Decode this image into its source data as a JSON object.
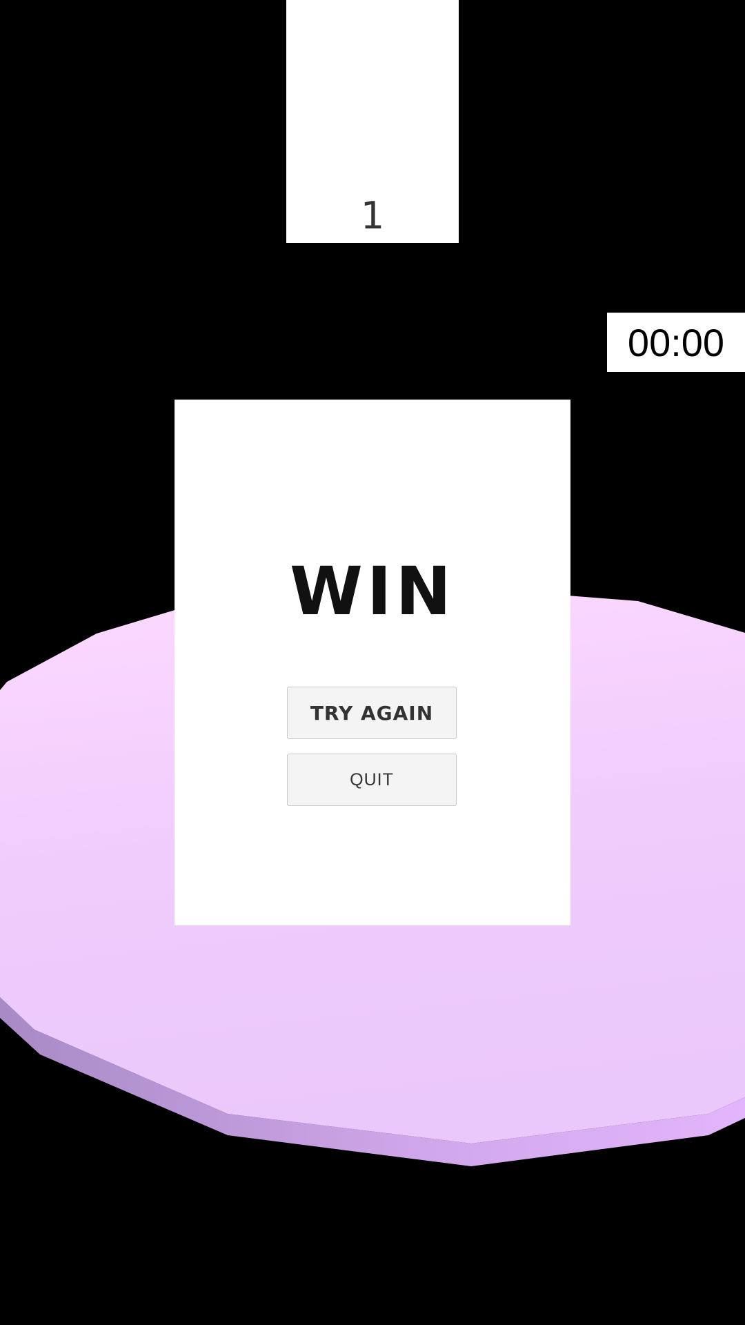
{
  "hud": {
    "level": "1",
    "timer": "00:00"
  },
  "win_panel": {
    "title": "WIN",
    "try_again_label": "TRY AGAIN",
    "quit_label": "QUIT"
  },
  "colors": {
    "background": "#000000",
    "platform_top_light": "#fcd8ff",
    "platform_top_dark": "#ebc8fb",
    "platform_side": "#b28fd0",
    "panel": "#ffffff",
    "button": "#f4f4f4"
  }
}
